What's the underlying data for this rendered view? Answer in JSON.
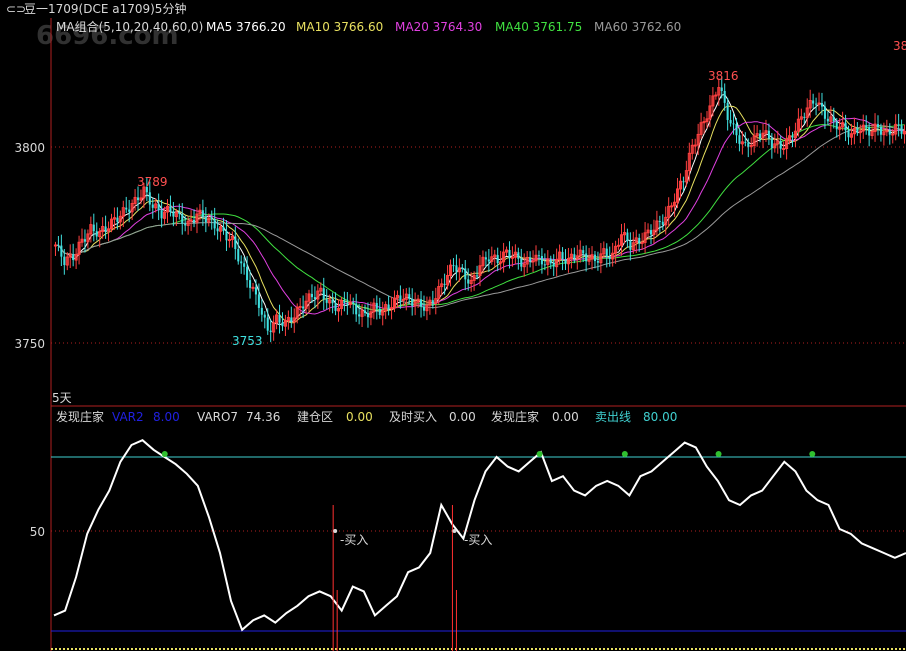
{
  "window": {
    "title": "豆一1709(DCE a1709)5分钟",
    "watermark": "6696.com"
  },
  "main_panel": {
    "ma_header": [
      {
        "label": "MA组合(5,10,20,40,60,0)",
        "color": "#d8d8d8"
      },
      {
        "label": "MA5 3766.20",
        "color": "#ffffff"
      },
      {
        "label": "MA10 3766.60",
        "color": "#e8e060"
      },
      {
        "label": "MA20 3764.30",
        "color": "#e040e0"
      },
      {
        "label": "MA40 3761.75",
        "color": "#40e040"
      },
      {
        "label": "MA60 3762.60",
        "color": "#9a9a9a"
      }
    ],
    "y_ticks": [
      "3800",
      "3750"
    ],
    "annotations": {
      "high1": "3789",
      "low1": "3753",
      "high2": "3816",
      "edge": "38"
    },
    "period_label": "5天"
  },
  "indicator_panel": {
    "header": [
      {
        "label": "发现庄家",
        "color": "#d8d8d8"
      },
      {
        "label": "VAR2",
        "color": "#2020e0"
      },
      {
        "label": "8.00",
        "color": "#2020e0"
      },
      {
        "label": "VARO7",
        "color": "#d8d8d8"
      },
      {
        "label": "74.36",
        "color": "#d8d8d8"
      },
      {
        "label": "建仓区",
        "color": "#d8d8d8"
      },
      {
        "label": "0.00",
        "color": "#e8e060"
      },
      {
        "label": "及时买入",
        "color": "#d8d8d8"
      },
      {
        "label": "0.00",
        "color": "#d8d8d8"
      },
      {
        "label": "发现庄家",
        "color": "#d8d8d8"
      },
      {
        "label": "0.00",
        "color": "#d8d8d8"
      },
      {
        "label": "卖出线",
        "color": "#40d0d0"
      },
      {
        "label": "80.00",
        "color": "#40d0d0"
      }
    ],
    "y_tick": "50",
    "buy_labels": [
      "买入",
      "买入"
    ]
  },
  "colors": {
    "background": "#000000",
    "frame": "#b02020",
    "up_candle": "#ff4040",
    "down_candle": "#40e0e0",
    "sell_line": "#40d0d0",
    "low_line": "#2020e0",
    "green_dot": "#30c030"
  },
  "chart_data": [
    {
      "type": "candlestick",
      "title": "豆一1709(DCE a1709)5分钟",
      "ylim": [
        3738,
        3820
      ],
      "y_ticks": [
        3800,
        3750
      ],
      "price_path": [
        3775,
        3771,
        3772,
        3776,
        3779,
        3778,
        3780,
        3782,
        3784,
        3786,
        3789,
        3785,
        3783,
        3784,
        3782,
        3780,
        3783,
        3782,
        3780,
        3778,
        3776,
        3770,
        3765,
        3760,
        3753,
        3756,
        3755,
        3757,
        3760,
        3762,
        3763,
        3760,
        3759,
        3761,
        3758,
        3757,
        3759,
        3758,
        3760,
        3762,
        3761,
        3760,
        3759,
        3762,
        3766,
        3770,
        3768,
        3765,
        3770,
        3772,
        3771,
        3773,
        3772,
        3770,
        3772,
        3771,
        3770,
        3772,
        3771,
        3773,
        3772,
        3771,
        3773,
        3772,
        3778,
        3775,
        3776,
        3778,
        3780,
        3782,
        3787,
        3792,
        3800,
        3805,
        3810,
        3816,
        3808,
        3803,
        3800,
        3802,
        3804,
        3801,
        3800,
        3802,
        3806,
        3810,
        3812,
        3808,
        3806,
        3805,
        3803,
        3805,
        3804,
        3805,
        3803,
        3805,
        3804
      ],
      "labels": {
        "high1": 3789,
        "low1": 3753,
        "high2": 3816
      },
      "ma": {
        "MA5": 3766.2,
        "MA10": 3766.6,
        "MA20": 3764.3,
        "MA40": 3761.75,
        "MA60": 3762.6
      }
    },
    {
      "type": "line",
      "name": "发现庄家",
      "ylim": [
        0,
        100
      ],
      "y_ticks": [
        50
      ],
      "reference_lines": {
        "卖出线": 80,
        "VAR2": 8
      },
      "values": [
        14,
        16,
        30,
        48,
        58,
        66,
        78,
        85,
        87,
        83,
        80,
        77,
        73,
        68,
        55,
        40,
        20,
        8,
        12,
        14,
        11,
        15,
        18,
        22,
        24,
        22,
        16,
        26,
        24,
        14,
        18,
        22,
        32,
        34,
        40,
        60,
        52,
        46,
        62,
        74,
        80,
        76,
        74,
        78,
        82,
        70,
        72,
        66,
        64,
        68,
        70,
        68,
        64,
        72,
        74,
        78,
        82,
        86,
        84,
        76,
        70,
        62,
        60,
        64,
        66,
        72,
        78,
        74,
        66,
        62,
        60,
        50,
        48,
        44,
        42,
        40,
        38,
        40
      ],
      "buy_signals": [
        0.33,
        0.47
      ],
      "green_dots": [
        0.13,
        0.57,
        0.67,
        0.78,
        0.89
      ]
    }
  ]
}
